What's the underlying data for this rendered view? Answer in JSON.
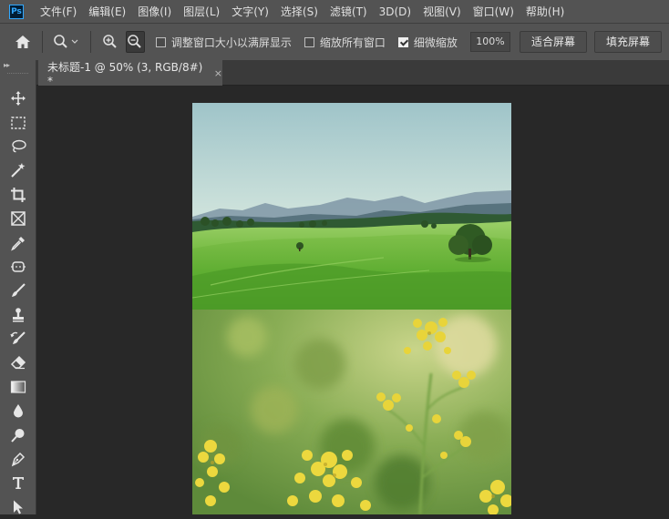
{
  "app": {
    "logo_text": "Ps"
  },
  "menu": [
    {
      "label": "文件(F)"
    },
    {
      "label": "编辑(E)"
    },
    {
      "label": "图像(I)"
    },
    {
      "label": "图层(L)"
    },
    {
      "label": "文字(Y)"
    },
    {
      "label": "选择(S)"
    },
    {
      "label": "滤镜(T)"
    },
    {
      "label": "3D(D)"
    },
    {
      "label": "视图(V)"
    },
    {
      "label": "窗口(W)"
    },
    {
      "label": "帮助(H)"
    }
  ],
  "options": {
    "resize_windows": {
      "label": "调整窗口大小以满屏显示",
      "checked": false
    },
    "zoom_all_windows": {
      "label": "缩放所有窗口",
      "checked": false
    },
    "scrubby_zoom": {
      "label": "细微缩放",
      "checked": true
    },
    "zoom_value": "100%",
    "fit_screen_label": "适合屏幕",
    "fill_screen_label": "填充屏幕"
  },
  "tools": [
    {
      "icon": "move-icon"
    },
    {
      "icon": "marquee-icon"
    },
    {
      "icon": "lasso-icon"
    },
    {
      "icon": "magic-wand-icon"
    },
    {
      "icon": "crop-icon"
    },
    {
      "icon": "frame-icon"
    },
    {
      "icon": "eyedropper-icon"
    },
    {
      "icon": "healing-brush-icon"
    },
    {
      "icon": "brush-icon"
    },
    {
      "icon": "clone-stamp-icon"
    },
    {
      "icon": "history-brush-icon"
    },
    {
      "icon": "eraser-icon"
    },
    {
      "icon": "gradient-icon"
    },
    {
      "icon": "blur-icon"
    },
    {
      "icon": "dodge-icon"
    },
    {
      "icon": "pen-icon"
    },
    {
      "icon": "type-icon"
    },
    {
      "icon": "path-selection-icon"
    }
  ],
  "document_tab": {
    "title": "未标题-1 @ 50% (3, RGB/8#) *",
    "close": "×"
  },
  "colors": {
    "ui_dark": "#535353",
    "workspace": "#282828",
    "accent": "#31a8ff"
  }
}
